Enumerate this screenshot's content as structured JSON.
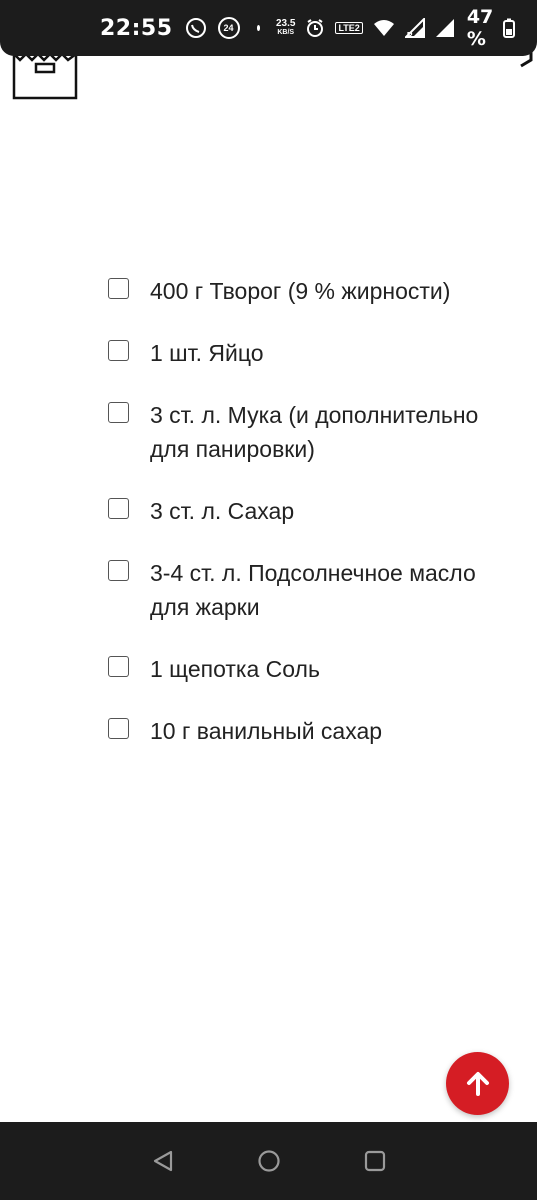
{
  "status_bar": {
    "time": "22:55",
    "notification_badge": "24",
    "net_speed_value": "23.5",
    "net_speed_unit": "KB/S",
    "lte_label": "LTE2",
    "signal_roaming": "R",
    "battery_percent": "47 %",
    "icons": [
      "viber-icon",
      "notification-badge-icon",
      "alarm-icon",
      "volte-icon",
      "wifi-icon",
      "signal-icon",
      "battery-icon"
    ]
  },
  "ingredients": [
    {
      "text": "400 г Творог (9 % жирности)",
      "checked": false
    },
    {
      "text": "1 шт. Яйцо",
      "checked": false
    },
    {
      "text": "3 ст. л. Мука (и дополнительно для панировки)",
      "checked": false
    },
    {
      "text": "3 ст. л. Сахар",
      "checked": false
    },
    {
      "text": "3-4 ст. л. Подсолнечное масло для жарки",
      "checked": false
    },
    {
      "text": "1 щепотка Соль",
      "checked": false
    },
    {
      "text": "10 г ванильный сахар",
      "checked": false
    }
  ],
  "colors": {
    "accent": "#d51d24",
    "status_bar": "#1c1c1c",
    "text": "#222222"
  },
  "scroll_top": {
    "icon": "arrow-up-icon"
  },
  "nav_bar": {
    "icons": [
      "back-icon",
      "home-icon",
      "recents-icon"
    ]
  }
}
